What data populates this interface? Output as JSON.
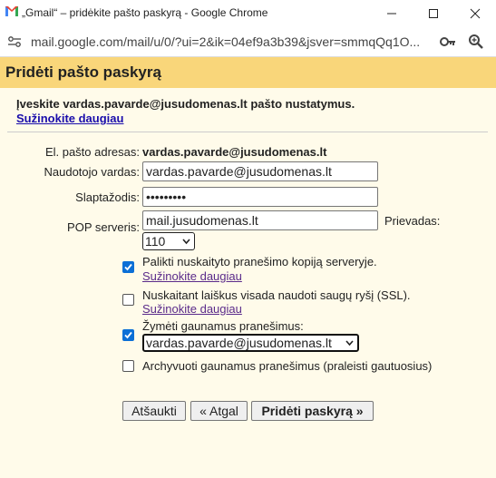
{
  "window": {
    "title": "„Gmail“ – pridėkite pašto paskyrą - Google Chrome",
    "url": "mail.google.com/mail/u/0/?ui=2&ik=04ef9a3b39&jsver=smmqQq1O..."
  },
  "dialog": {
    "heading": "Pridėti pašto paskyrą",
    "intro": "Įveskite vardas.pavarde@jusudomenas.lt pašto nustatymus.",
    "learn_more": "Sužinokite daugiau"
  },
  "form": {
    "email_label": "El. pašto adresas:",
    "email_value": "vardas.pavarde@jusudomenas.lt",
    "username_label": "Naudotojo vardas:",
    "username_value": "vardas.pavarde@jusudomenas.lt",
    "password_label": "Slaptažodis:",
    "password_value": "•••••••••",
    "pop_label": "POP serveris:",
    "pop_value": "mail.jusudomenas.lt",
    "port_label": "Prievadas:",
    "port_value": "110"
  },
  "options": [
    {
      "checked": true,
      "label": "Palikti nuskaityto pranešimo kopiją serveryje.",
      "link": "Sužinokite daugiau"
    },
    {
      "checked": false,
      "label": "Nuskaitant laiškus visada naudoti saugų ryšį (SSL).",
      "link": "Sužinokite daugiau"
    },
    {
      "checked": true,
      "label": "Žymėti gaunamus pranešimus:",
      "select_value": "vardas.pavarde@jusudomenas.lt"
    },
    {
      "checked": false,
      "label": "Archyvuoti gaunamus pranešimus (praleisti gautuosius)"
    }
  ],
  "buttons": {
    "cancel": "Atšaukti",
    "back": "« Atgal",
    "add": "Pridėti paskyrą »"
  },
  "colors": {
    "header_bg": "#f9d67a",
    "page_bg": "#fffbea",
    "checkbox_on": "#0b6fd6",
    "link": "#1a0dab"
  }
}
